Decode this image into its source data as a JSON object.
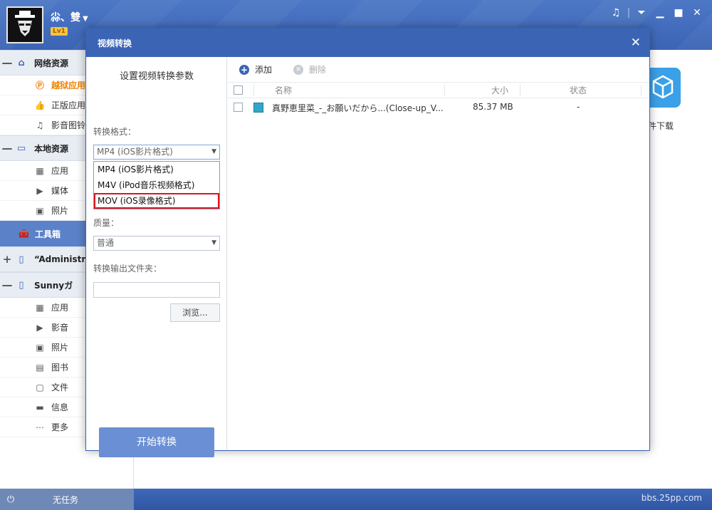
{
  "header": {
    "username": "尛、雙",
    "level": "Lv1",
    "window_controls": [
      "music-icon",
      "menu-icon",
      "minimize-icon",
      "maximize-icon",
      "close-icon"
    ]
  },
  "sidebar": {
    "groups": [
      {
        "label": "网络资源",
        "toggle": "—",
        "icon": "home-icon",
        "items": [
          {
            "label": "越狱应用",
            "icon": "p-store-icon",
            "active": true
          },
          {
            "label": "正版应用",
            "icon": "thumb-icon"
          },
          {
            "label": "影音图铃",
            "icon": "music-note-icon"
          }
        ]
      },
      {
        "label": "本地资源",
        "toggle": "—",
        "icon": "monitor-icon",
        "items": [
          {
            "label": "应用",
            "icon": "grid-icon"
          },
          {
            "label": "媒体",
            "icon": "camera-icon"
          },
          {
            "label": "照片",
            "icon": "photo-icon"
          }
        ]
      },
      {
        "label": "工具箱",
        "icon": "toolbox-icon"
      },
      {
        "label": "“Administr",
        "toggle": "+",
        "icon": "phone-icon"
      },
      {
        "label": "Sunnyガ",
        "toggle": "—",
        "icon": "phone-icon",
        "items": [
          {
            "label": "应用",
            "icon": "grid-icon"
          },
          {
            "label": "影音",
            "icon": "camera-icon"
          },
          {
            "label": "照片",
            "icon": "photo-icon"
          },
          {
            "label": "图书",
            "icon": "book-icon"
          },
          {
            "label": "文件",
            "icon": "file-icon"
          },
          {
            "label": "信息",
            "icon": "message-icon"
          },
          {
            "label": "更多",
            "icon": "more-icon"
          }
        ]
      }
    ]
  },
  "background": {
    "tile_label": "件下载"
  },
  "status": {
    "text": "无任务"
  },
  "watermark": "bbs.25pp.com",
  "dialog": {
    "title": "视频转换",
    "left": {
      "heading": "设置视频转换参数",
      "format_label": "转换格式：",
      "format_value": "MP4 (iOS影片格式)",
      "format_options": [
        "MP4 (iOS影片格式)",
        "M4V (iPod音乐视频格式)",
        "MOV (iOS录像格式)"
      ],
      "highlighted_option": 2,
      "quality_label": "质量：",
      "quality_value": "普通",
      "output_label": "转换输出文件夹：",
      "output_value": "",
      "browse_label": "浏览...",
      "start_label": "开始转换"
    },
    "right": {
      "add_label": "添加",
      "delete_label": "删除",
      "columns": {
        "name": "名称",
        "size": "大小",
        "status": "状态"
      },
      "rows": [
        {
          "name": "真野恵里菜_-_お願いだから...(Close-up_V...",
          "size": "85.37 MB",
          "status": "-"
        }
      ]
    }
  }
}
